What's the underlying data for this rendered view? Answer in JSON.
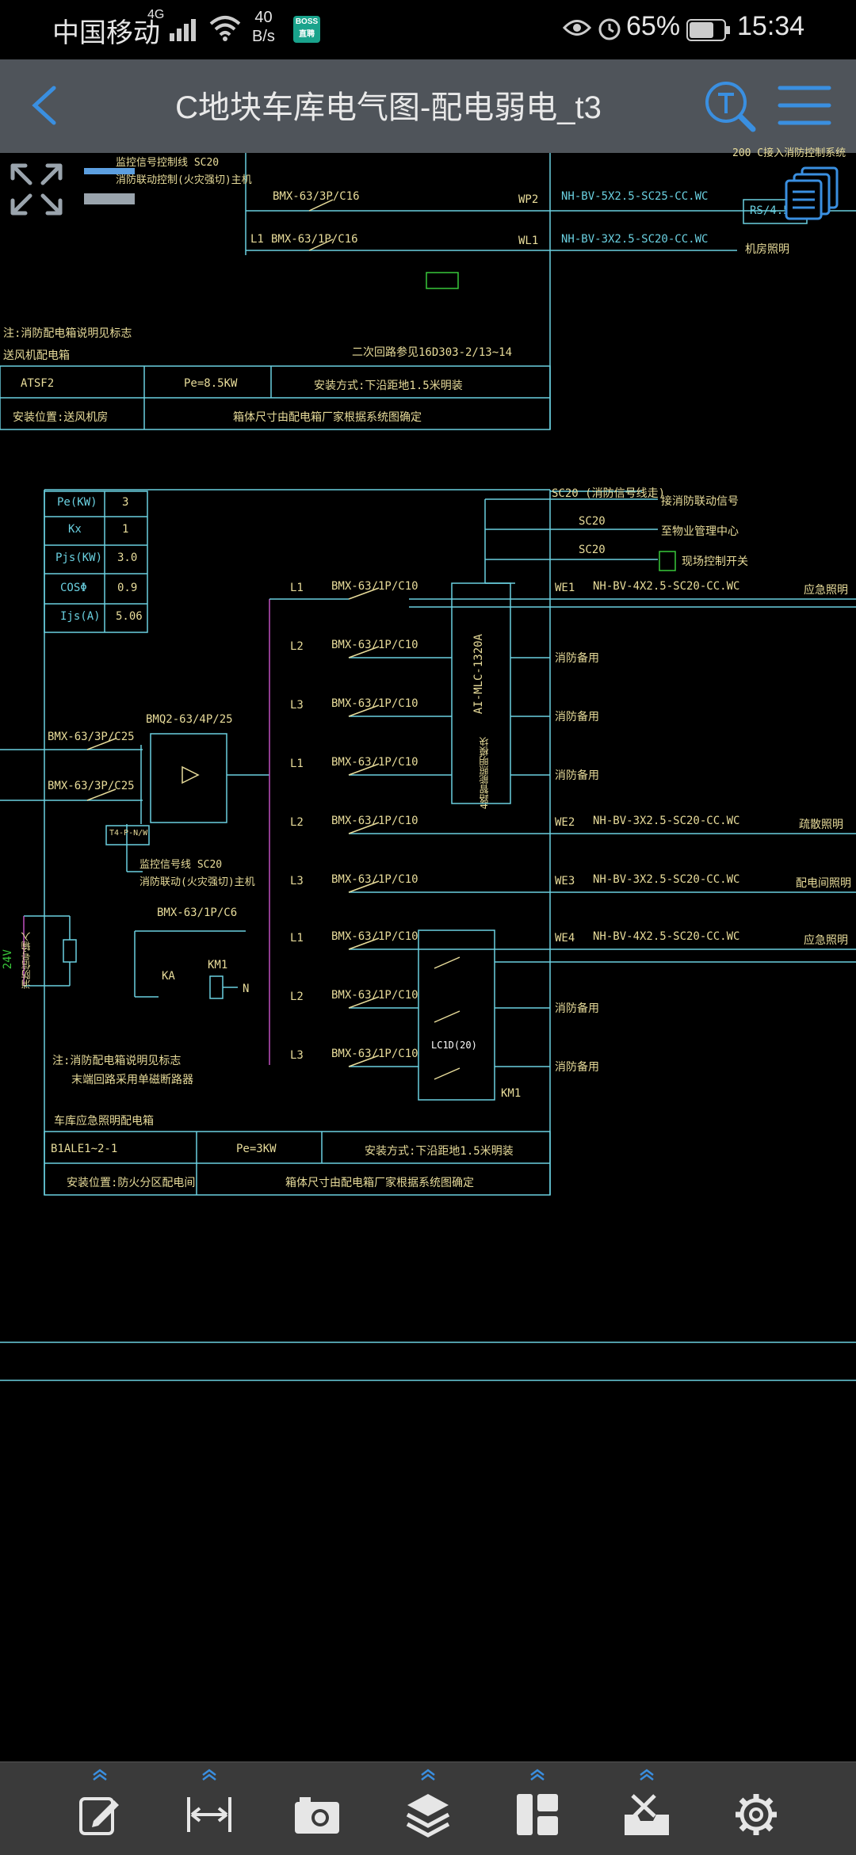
{
  "status_bar": {
    "carrier": "中国移动",
    "network": "4G",
    "speed_value": "40",
    "speed_unit": "B/s",
    "app_badge": "BOSS直聘",
    "battery": "65%",
    "time": "15:34"
  },
  "app_bar": {
    "title": "C地块车库电气图-配电弱电_t3",
    "icons": [
      "back-icon",
      "text-search-icon",
      "menu-icon"
    ]
  },
  "drawing": {
    "top_panel": {
      "cut_text_1": "监控信号控制线 SC20",
      "cut_text_2": "消防联动控制(火灾强切)主机",
      "cut_text_top_right": "200 C接入消防控制系统",
      "circuit1_breaker": "BMX-63/3P/C16",
      "circuit1_code": "WP2",
      "circuit1_cable": "NH-BV-5X2.5-SC25-CC.WC",
      "circuit1_load": "RS/4.5KW",
      "circuit2_phase": "L1",
      "circuit2_breaker": "BMX-63/1P/C16",
      "circuit2_code": "WL1",
      "circuit2_cable": "NH-BV-3X2.5-SC20-CC.WC",
      "circuit2_load": "机房照明",
      "note_1": "注:消防配电箱说明见标志",
      "note_2": "送风机配电箱",
      "ref": "二次回路参见16D303-2/13~14",
      "panel_name": "ATSF2",
      "panel_power": "Pe=8.5KW",
      "panel_install": "安装方式:下沿距地1.5米明装",
      "panel_location": "安装位置:送风机房",
      "panel_note": "箱体尺寸由配电箱厂家根据系统图确定"
    },
    "load_table": [
      {
        "key": "Pe(KW)",
        "value": "3"
      },
      {
        "key": "Kx",
        "value": "1"
      },
      {
        "key": "Pjs(KW)",
        "value": "3.0"
      },
      {
        "key": "COSΦ",
        "value": "0.9"
      },
      {
        "key": "Ijs(A)",
        "value": "5.06"
      }
    ],
    "inputs": {
      "breaker_1": "BMX-63/3P/C25",
      "breaker_2": "BMX-63/3P/C25",
      "ats": "BMQ2-63/4P/25",
      "ats_label": "T4-P-N/W",
      "signal_note_1": "监控信号线 SC20",
      "signal_note_2": "消防联动(火灾强切)主机",
      "control_breaker": "BMX-63/1P/C6",
      "ka": "KA",
      "km": "KM1",
      "n": "N",
      "v24": "24V",
      "fire_signal": "消防信号输入"
    },
    "signals": {
      "sc20_head": "SC20 (消防信号线走)",
      "to_fire_link": "接消防联动信号",
      "sc20_2": "SC20",
      "to_fire_center": "至物业管理中心",
      "sc20_3": "SC20",
      "to_local_switch": "现场控制开关"
    },
    "module": {
      "name": "AI-MLC-1320A",
      "sub": "4路智能照明模块",
      "contactor": "LC1D(20)",
      "contactor_km": "KM1"
    },
    "circuits": [
      {
        "phase": "L1",
        "breaker": "BMX-63/1P/C10",
        "code": "WE1",
        "cable": "NH-BV-4X2.5-SC20-CC.WC",
        "load": "应急照明"
      },
      {
        "phase": "L2",
        "breaker": "BMX-63/1P/C10",
        "code": "",
        "cable": "",
        "load": "消防备用"
      },
      {
        "phase": "L3",
        "breaker": "BMX-63/1P/C10",
        "code": "",
        "cable": "",
        "load": "消防备用"
      },
      {
        "phase": "L1",
        "breaker": "BMX-63/1P/C10",
        "code": "",
        "cable": "",
        "load": "消防备用"
      },
      {
        "phase": "L2",
        "breaker": "BMX-63/1P/C10",
        "code": "WE2",
        "cable": "NH-BV-3X2.5-SC20-CC.WC",
        "load": "疏散照明"
      },
      {
        "phase": "L3",
        "breaker": "BMX-63/1P/C10",
        "code": "WE3",
        "cable": "NH-BV-3X2.5-SC20-CC.WC",
        "load": "配电间照明"
      },
      {
        "phase": "L1",
        "breaker": "BMX-63/1P/C10",
        "code": "WE4",
        "cable": "NH-BV-4X2.5-SC20-CC.WC",
        "load": "应急照明"
      },
      {
        "phase": "L2",
        "breaker": "BMX-63/1P/C10",
        "code": "",
        "cable": "",
        "load": "消防备用"
      },
      {
        "phase": "L3",
        "breaker": "BMX-63/1P/C10",
        "code": "",
        "cable": "",
        "load": "消防备用"
      }
    ],
    "bottom_panel": {
      "note_1": "注:消防配电箱说明见标志",
      "note_2": "末端回路采用单磁断路器",
      "title": "车库应急照明配电箱",
      "panel_name": "B1ALE1~2-1",
      "panel_power": "Pe=3KW",
      "panel_install": "安装方式:下沿距地1.5米明装",
      "panel_location": "安装位置:防火分区配电间",
      "panel_note": "箱体尺寸由配电箱厂家根据系统图确定"
    }
  },
  "overlay": {
    "icons": [
      "expand-icon",
      "bars-icon",
      "layers-list-icon"
    ]
  },
  "toolbar": {
    "items": [
      {
        "name": "edit-tool",
        "icon": "edit-icon"
      },
      {
        "name": "measure-tool",
        "icon": "measure-icon"
      },
      {
        "name": "camera-tool",
        "icon": "camera-icon"
      },
      {
        "name": "layers-tool",
        "icon": "layers-icon"
      },
      {
        "name": "layout-tool",
        "icon": "layout-icon"
      },
      {
        "name": "toolbox-tool",
        "icon": "toolbox-icon"
      },
      {
        "name": "settings-tool",
        "icon": "gear-icon"
      }
    ]
  },
  "colors": {
    "app_bar": "#4f545a",
    "accent": "#3a8fe0",
    "cad_cyan": "#6ad0e0",
    "cad_yellow": "#e8dc9a",
    "cad_green": "#39c83a",
    "cad_magenta": "#c050c0",
    "toolbar": "#3a3a3a"
  }
}
